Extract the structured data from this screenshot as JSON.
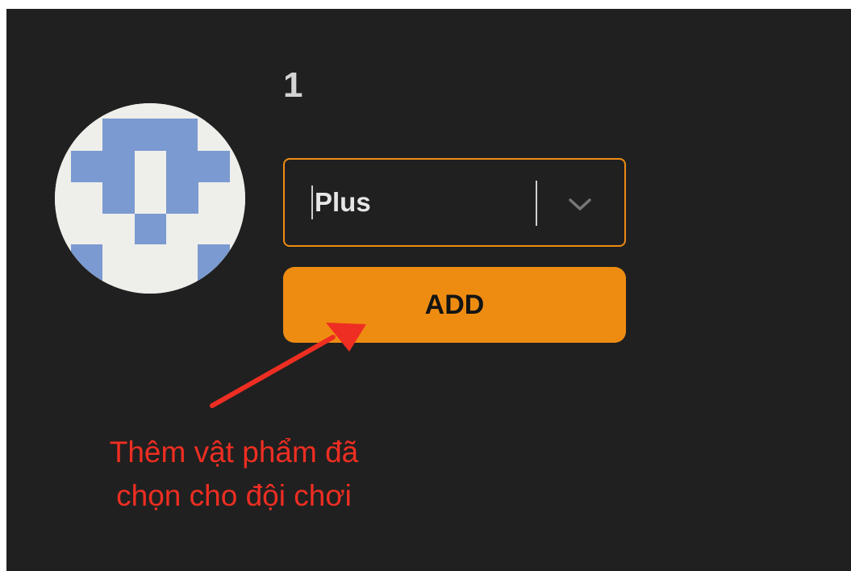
{
  "team": {
    "number": "1",
    "avatar_icon": "pixel-identicon"
  },
  "item_select": {
    "selected": "Plus",
    "dropdown_icon": "chevron-down-icon"
  },
  "add_button": {
    "label": "ADD"
  },
  "annotation": {
    "line1": "Thêm vật phẩm đã",
    "line2": "chọn cho đội chơi"
  },
  "colors": {
    "background": "#202020",
    "accent": "#ee8c12",
    "annotation": "#ee2e22",
    "avatar_blue": "#7b9ad1",
    "avatar_bg": "#eeeeea"
  }
}
